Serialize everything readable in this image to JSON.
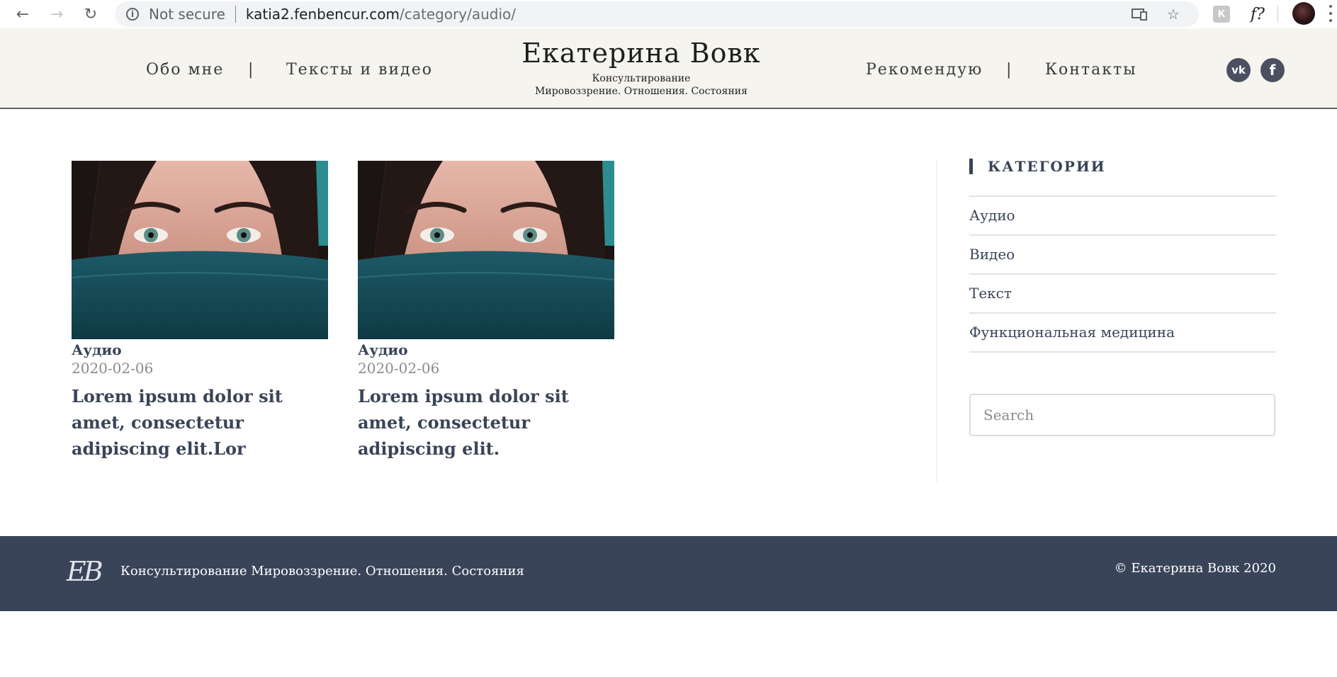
{
  "browser": {
    "security_label": "Not secure",
    "url_host": "katia2.fenbencur.com",
    "url_path": "/category/audio/",
    "ext_k_label": "К",
    "ext_f_label": "f?"
  },
  "header": {
    "nav_left": [
      "Обо мне",
      "Тексты и видео"
    ],
    "nav_right": [
      "Рекомендую",
      "Контакты"
    ],
    "separator": "|",
    "title": "Екатерина Вовк",
    "subtitle_line1": "Консультирование",
    "subtitle_line2": "Мировоззрение. Отношения. Состояния",
    "social": {
      "vk_label": "vk",
      "fb_label": "f"
    }
  },
  "posts": [
    {
      "category": "Аудио",
      "date": "2020-02-06",
      "title": "Lorem ipsum dolor sit amet, consectetur adipiscing elit.Lor"
    },
    {
      "category": "Аудио",
      "date": "2020-02-06",
      "title": "Lorem ipsum dolor sit amet, consectetur adipiscing elit."
    }
  ],
  "sidebar": {
    "categories_title": "КАТЕГОРИИ",
    "categories": [
      "Аудио",
      "Видео",
      "Текст",
      "Функциональная медицина"
    ],
    "search_placeholder": "Search"
  },
  "footer": {
    "logo": "ЕВ",
    "tagline": "Консультирование Мировоззрение. Отношения. Состояния",
    "copyright": "© Екатерина Вовк 2020"
  },
  "colors": {
    "header_bg": "#f5f4ef",
    "accent": "#3a4458",
    "footer_bg": "#394459"
  }
}
